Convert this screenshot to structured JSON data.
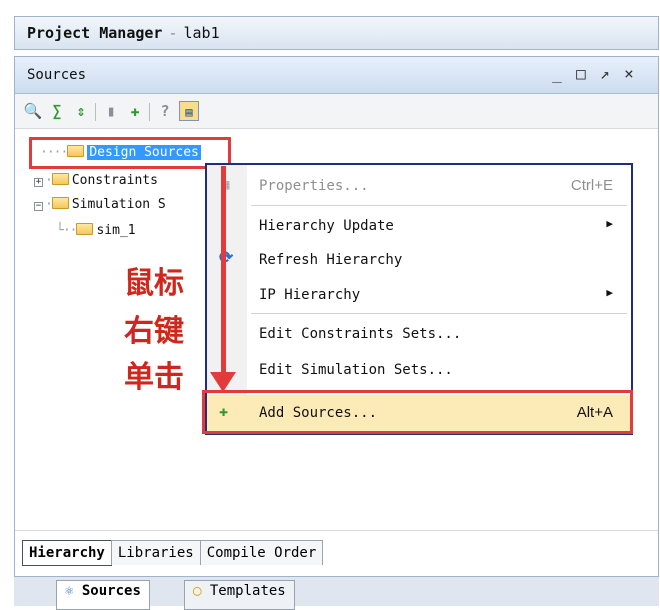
{
  "window": {
    "title": "Project Manager",
    "separator": "-",
    "project": "lab1"
  },
  "panel": {
    "title": "Sources",
    "controls": [
      "_",
      "□",
      "↗",
      "×"
    ]
  },
  "toolbar": {
    "icons": [
      "search-icon",
      "collapse-all-icon",
      "expand-all-icon",
      "open-folder-icon",
      "add-sources-icon",
      "help-icon",
      "show-hierarchy-icon"
    ]
  },
  "tree": {
    "items": [
      {
        "label": "Design Sources",
        "selected": true
      },
      {
        "label": "Constraints",
        "expander": "+"
      },
      {
        "label": "Simulation S",
        "expander": "−"
      },
      {
        "label": "sim_1"
      }
    ]
  },
  "context_menu": {
    "items": [
      {
        "label": "Properties...",
        "shortcut": "Ctrl+E",
        "disabled": true
      },
      {
        "label": "Hierarchy Update",
        "submenu": "▶"
      },
      {
        "label": "Refresh Hierarchy"
      },
      {
        "label": "IP Hierarchy",
        "submenu": "▶"
      },
      {
        "label": "Edit Constraints Sets..."
      },
      {
        "label": "Edit Simulation Sets..."
      },
      {
        "label": "Add Sources...",
        "shortcut": "Alt+A",
        "highlighted": true
      }
    ]
  },
  "annotation": {
    "line1": "鼠标",
    "line2": "右键",
    "line3": "单击",
    "color": "#d0271d"
  },
  "bottom_tabs": [
    "Hierarchy",
    "Libraries",
    "Compile Order"
  ],
  "lower_tabs": [
    "Sources",
    "Templates"
  ]
}
